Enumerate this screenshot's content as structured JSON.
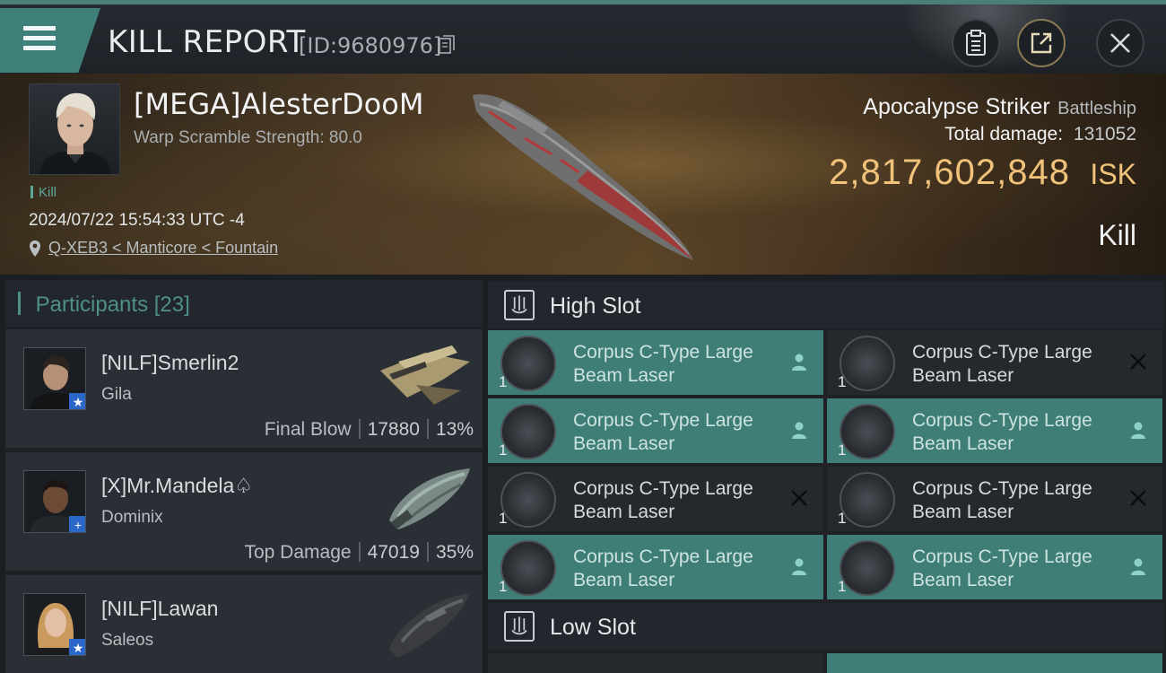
{
  "header": {
    "title": "KILL REPORT",
    "report_id": "[ID:9680976]"
  },
  "victim": {
    "name": "[MEGA]AlesterDooM",
    "warp_scramble": "Warp Scramble Strength: 80.0",
    "kill_tag": "Kill",
    "datetime": "2024/07/22 15:54:33 UTC -4",
    "location": "Q-XEB3 < Manticore < Fountain",
    "ship_name": "Apocalypse Striker",
    "ship_class": "Battleship",
    "total_damage_label": "Total damage:",
    "total_damage": "131052",
    "isk_value": "2,817,602,848",
    "isk_unit": "ISK",
    "result": "Kill"
  },
  "participants": {
    "label": "Participants",
    "count": "[23]",
    "items": [
      {
        "name": "[NILF]Smerlin2",
        "ship": "Gila",
        "role": "Final Blow",
        "damage": "17880",
        "percent": "13%",
        "badge": "★"
      },
      {
        "name": "[X]Mr.Mandela♤",
        "ship": "Dominix",
        "role": "Top Damage",
        "damage": "47019",
        "percent": "35%",
        "badge": "+"
      },
      {
        "name": "[NILF]Lawan",
        "ship": "Saleos",
        "role": "",
        "damage": "",
        "percent": "",
        "badge": "★"
      }
    ]
  },
  "slots": {
    "high": {
      "label": "High Slot",
      "items": [
        {
          "name": "Corpus C-Type Large Beam Laser",
          "qty": "1",
          "status": "fitted"
        },
        {
          "name": "Corpus C-Type Large Beam Laser",
          "qty": "1",
          "status": "destroyed"
        },
        {
          "name": "Corpus C-Type Large Beam Laser",
          "qty": "1",
          "status": "fitted"
        },
        {
          "name": "Corpus C-Type Large Beam Laser",
          "qty": "1",
          "status": "fitted"
        },
        {
          "name": "Corpus C-Type Large Beam Laser",
          "qty": "1",
          "status": "destroyed"
        },
        {
          "name": "Corpus C-Type Large Beam Laser",
          "qty": "1",
          "status": "destroyed"
        },
        {
          "name": "Corpus C-Type Large Beam Laser",
          "qty": "1",
          "status": "fitted"
        },
        {
          "name": "Corpus C-Type Large Beam Laser",
          "qty": "1",
          "status": "fitted"
        }
      ]
    },
    "low": {
      "label": "Low Slot"
    }
  },
  "colors": {
    "accent": "#3e7e77",
    "isk": "#f0c27a",
    "panel": "#2a2f35"
  }
}
